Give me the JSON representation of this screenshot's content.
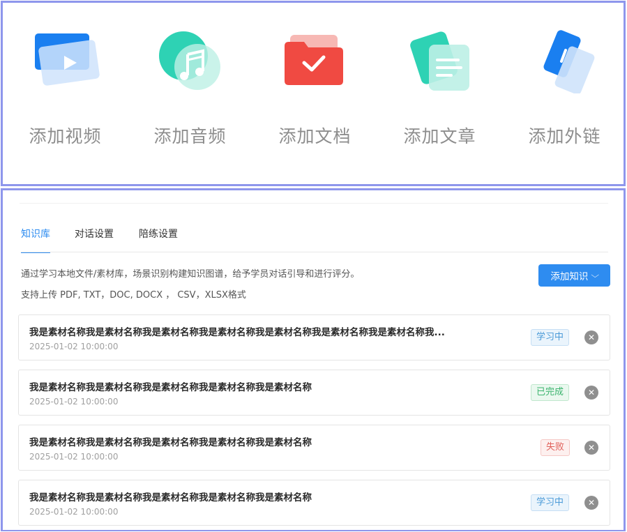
{
  "add_menu": {
    "items": [
      {
        "label": "添加视频",
        "icon": "video-icon"
      },
      {
        "label": "添加音频",
        "icon": "audio-icon"
      },
      {
        "label": "添加文档",
        "icon": "document-folder-icon"
      },
      {
        "label": "添加文章",
        "icon": "article-icon"
      },
      {
        "label": "添加外链",
        "icon": "external-link-icon"
      }
    ]
  },
  "tabs": [
    {
      "label": "知识库",
      "active": true
    },
    {
      "label": "对话设置",
      "active": false
    },
    {
      "label": "陪练设置",
      "active": false
    }
  ],
  "knowledge": {
    "description": "通过学习本地文件/素材库，场景识别构建知识图谱，给予学员对话引导和进行评分。",
    "formats_note": "支持上传 PDF, TXT，DOC, DOCX ， CSV，XLSX格式",
    "add_button_label": "添加知识",
    "add_button_icon": "chevron-down-icon",
    "remove_icon": "close-icon"
  },
  "files": [
    {
      "name": "我是素材名称我是素材名称我是素材名称我是素材名称我是素材名称我是素材名称我是素材名称我...",
      "time": "2025-01-02 10:00:00",
      "status": "学习中",
      "status_kind": "learning"
    },
    {
      "name": "我是素材名称我是素材名称我是素材名称我是素材名称我是素材名称",
      "time": "2025-01-02 10:00:00",
      "status": "已完成",
      "status_kind": "done"
    },
    {
      "name": "我是素材名称我是素材名称我是素材名称我是素材名称我是素材名称",
      "time": "2025-01-02 10:00:00",
      "status": "失败",
      "status_kind": "fail"
    },
    {
      "name": "我是素材名称我是素材名称我是素材名称我是素材名称我是素材名称",
      "time": "2025-01-02 10:00:00",
      "status": "学习中",
      "status_kind": "learning"
    }
  ],
  "colors": {
    "accent": "#2e8cf0",
    "frame": "#8e96ec",
    "status_learning": "#4a9ad8",
    "status_done": "#3cb46e",
    "status_fail": "#e0605a"
  }
}
